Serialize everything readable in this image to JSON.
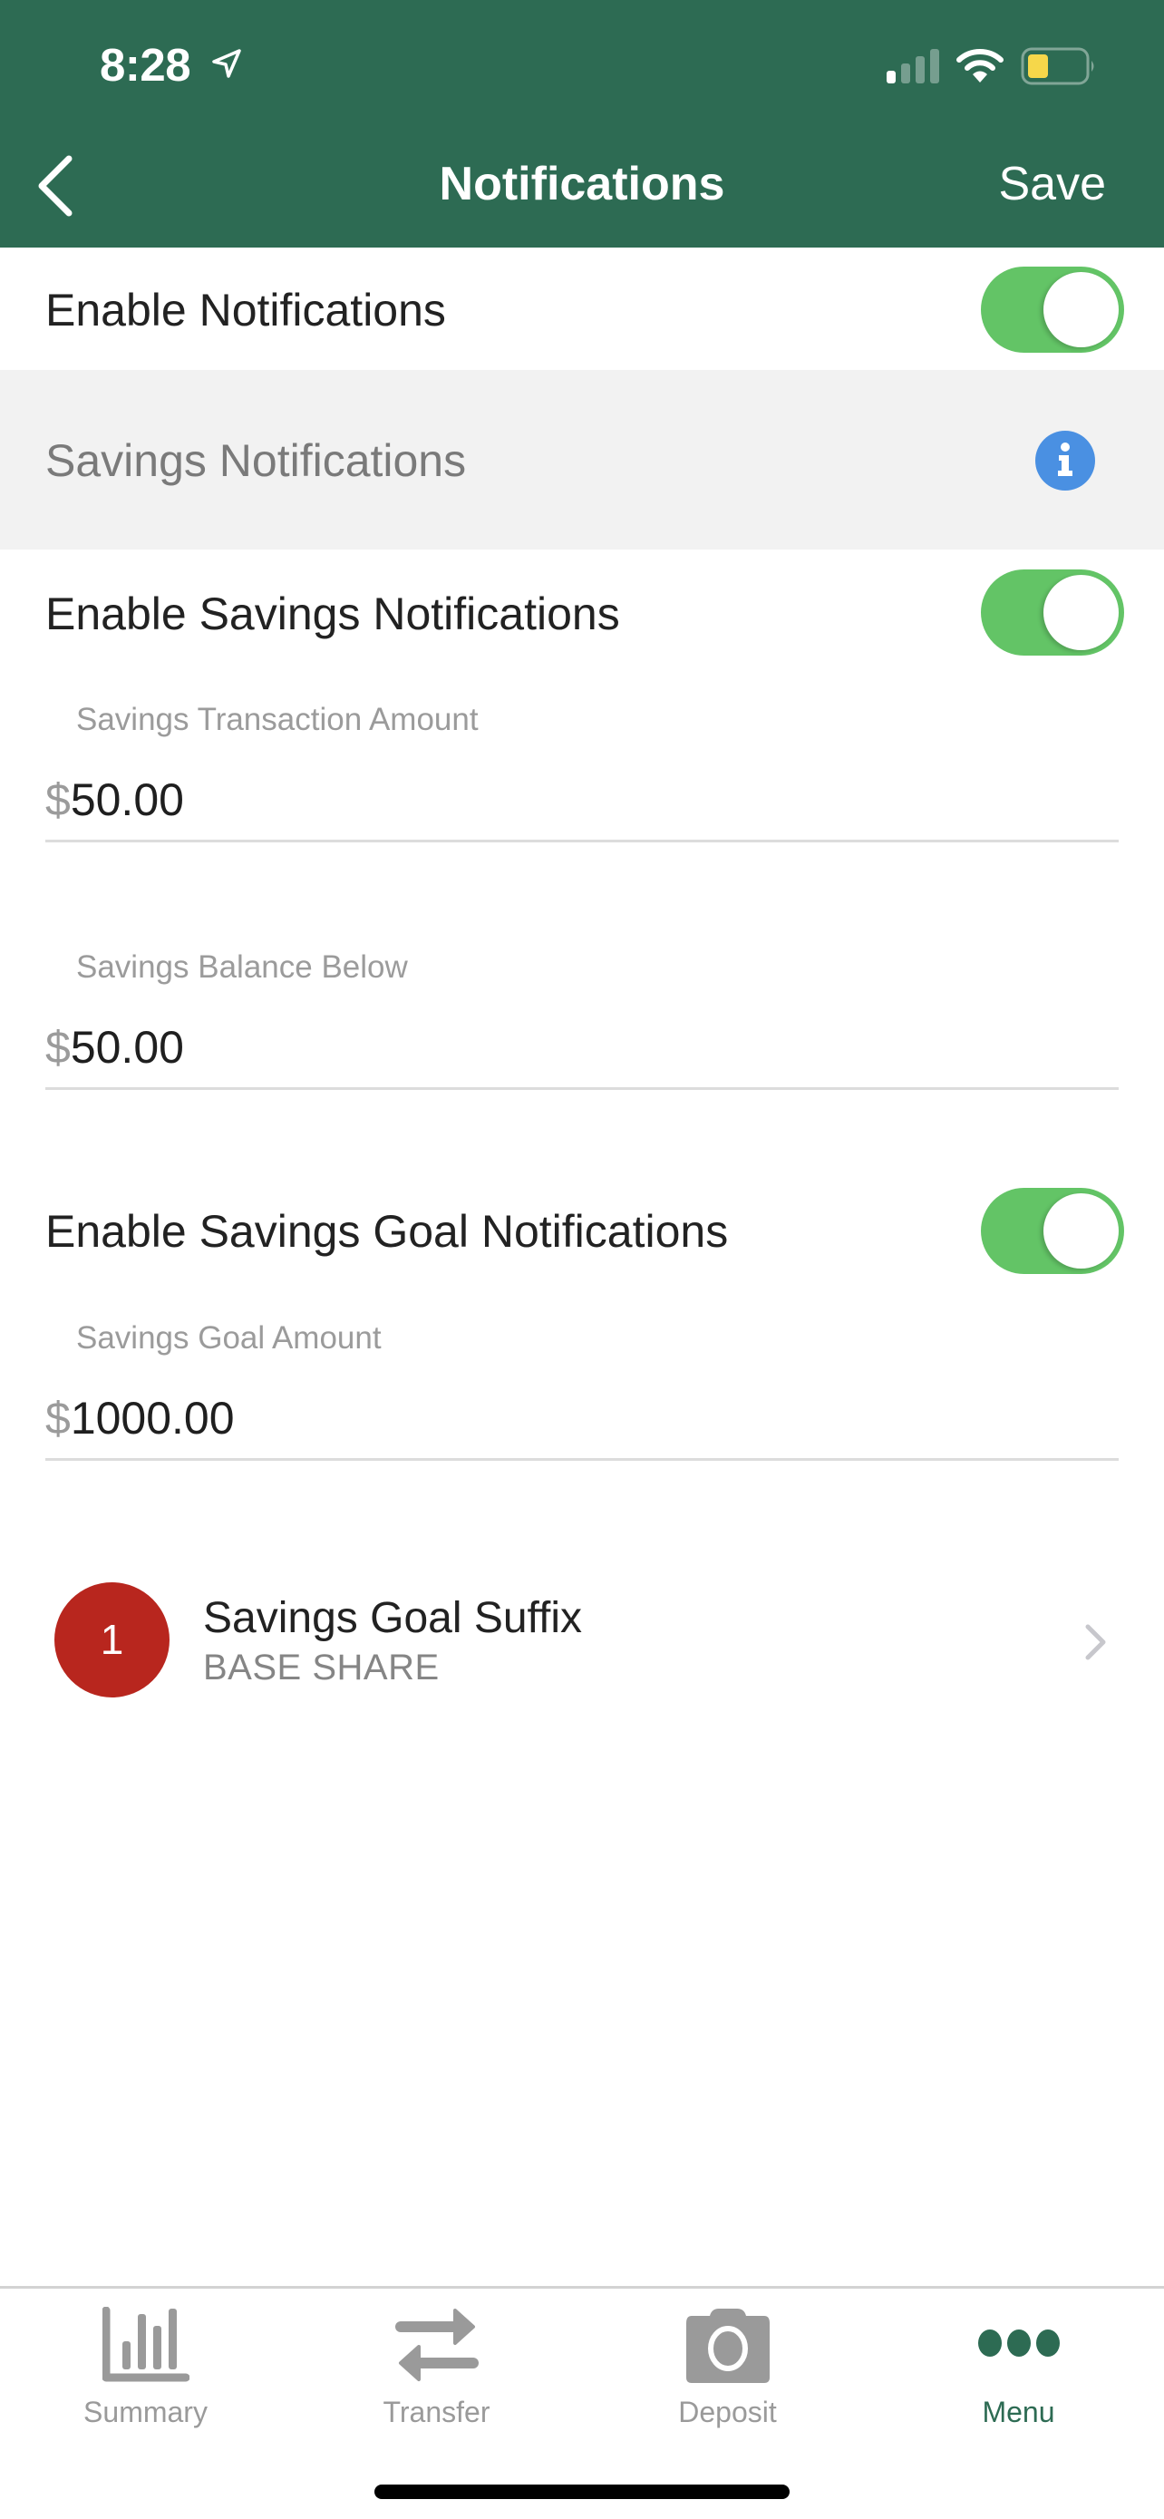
{
  "status_bar": {
    "time": "8:28",
    "location_icon": "location-arrow-icon",
    "signal_icon": "cellular-signal-icon",
    "wifi_icon": "wifi-icon",
    "battery_icon": "battery-low-icon",
    "battery_color": "#F6D74A"
  },
  "header": {
    "back_icon": "chevron-left-icon",
    "title": "Notifications",
    "save_label": "Save",
    "background_color": "#2D6B53"
  },
  "enable_notifications": {
    "label": "Enable Notifications",
    "on": true
  },
  "savings_section": {
    "title": "Savings Notifications",
    "info_icon": "info-icon",
    "enable_savings": {
      "label": "Enable Savings Notifications",
      "on": true
    },
    "fields": [
      {
        "label": "Savings Transaction Amount",
        "currency": "$",
        "value": "50.00"
      },
      {
        "label": "Savings Balance Below",
        "currency": "$",
        "value": "50.00"
      }
    ],
    "enable_goal": {
      "label": "Enable Savings Goal Notifications",
      "on": true
    },
    "goal_field": {
      "label": "Savings Goal Amount",
      "currency": "$",
      "value": "1000.00"
    },
    "goal_suffix": {
      "badge": "1",
      "title": "Savings Goal Suffix",
      "subtitle": "BASE SHARE",
      "chevron_icon": "chevron-right-icon"
    }
  },
  "tab_bar": {
    "active_color": "#2D6B53",
    "inactive_color": "#9A9A9A",
    "tabs": [
      {
        "label": "Summary",
        "icon": "bar-chart-icon",
        "active": false
      },
      {
        "label": "Transfer",
        "icon": "transfer-arrows-icon",
        "active": false
      },
      {
        "label": "Deposit",
        "icon": "camera-icon",
        "active": false
      },
      {
        "label": "Menu",
        "icon": "more-dots-icon",
        "active": true
      }
    ]
  },
  "colors": {
    "toggle_on": "#63C466",
    "info_blue": "#4A90E2",
    "badge_red": "#B8261E",
    "section_bg": "#F2F2F2"
  }
}
